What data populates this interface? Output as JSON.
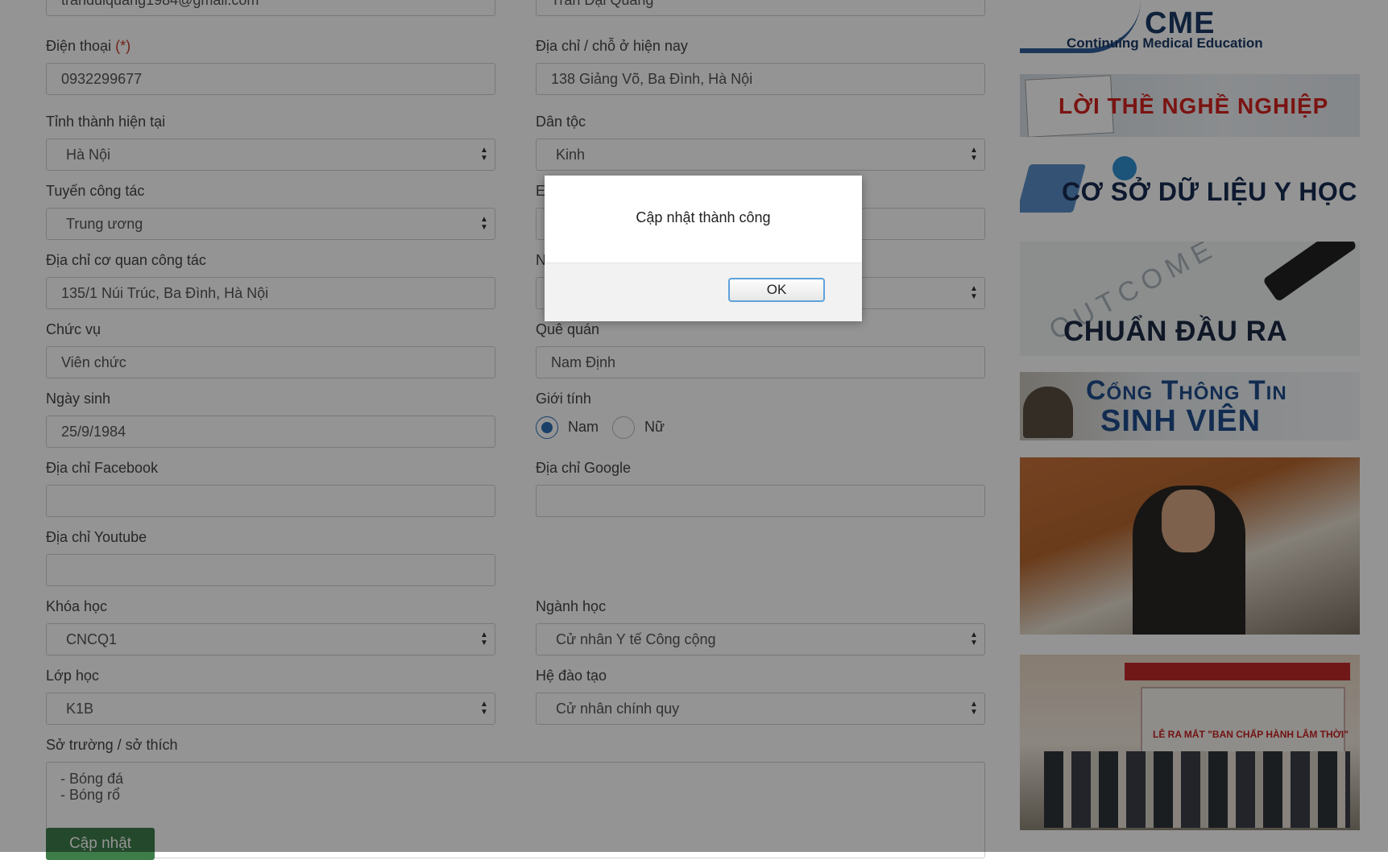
{
  "form": {
    "top_partial_left": "tranduiquang1984@gmail.com",
    "top_partial_right": "Trần Đại Quang",
    "phone_label": "Điện thoại",
    "required_mark": "(*)",
    "phone_value": "0932299677",
    "address_label": "Địa chỉ / chỗ ở hiện nay",
    "address_value": "138 Giảng Võ, Ba Đình, Hà Nội",
    "province_label": "Tỉnh thành hiện tại",
    "province_value": "Hà Nội",
    "ethnicity_label": "Dân tộc",
    "ethnicity_value": "Kinh",
    "level_label": "Tuyến công tác",
    "level_value": "Trung ương",
    "right_row3_label_partial": "E",
    "office_label": "Địa chỉ cơ quan công tác",
    "office_value": "135/1 Núi Trúc, Ba Đình, Hà Nội",
    "right_row4_label_partial": "N",
    "position_label": "Chức vụ",
    "position_value": "Viên chức",
    "hometown_label": "Quê quán",
    "hometown_value": "Nam Định",
    "dob_label": "Ngày sinh",
    "dob_value": "25/9/1984",
    "gender_label": "Giới tính",
    "gender_male": "Nam",
    "gender_female": "Nữ",
    "facebook_label": "Địa chỉ Facebook",
    "facebook_value": "",
    "google_label": "Địa chỉ Google",
    "google_value": "",
    "youtube_label": "Địa chỉ Youtube",
    "youtube_value": "",
    "course_label": "Khóa học",
    "course_value": "CNCQ1",
    "major_label": "Ngành học",
    "major_value": "Cử nhân Y tế Công cộng",
    "class_label": "Lớp học",
    "class_value": "K1B",
    "training_label": "Hệ đào tạo",
    "training_value": "Cử nhân chính quy",
    "hobbies_label": "Sở trường / sở thích",
    "hobbies_line1": "- Bóng đá",
    "hobbies_line2": "- Bóng rổ",
    "submit_label": "Cập nhật"
  },
  "sidebar": {
    "cme_title": "CME",
    "cme_subtitle": "Continuing Medical Education",
    "oath": "LỜI THỀ NGHỀ NGHIỆP",
    "database": "CƠ SỞ DỮ LIỆU Y HỌC",
    "outcomes_word": "OUTCOME",
    "outcomes": "CHUẨN ĐẦU RA",
    "portal_line1": "Cổng Thông Tin",
    "portal_line2": "SINH VIÊN",
    "event_banner": "LỄ RA MẮT \"BAN CHẤP HÀNH LÂM THỜI\""
  },
  "dialog": {
    "message": "Cập nhật thành công",
    "ok_label": "OK"
  },
  "colors": {
    "accent_green": "#3e7d4a",
    "required_red": "#c0392b",
    "ok_border": "#5ea2dc"
  }
}
